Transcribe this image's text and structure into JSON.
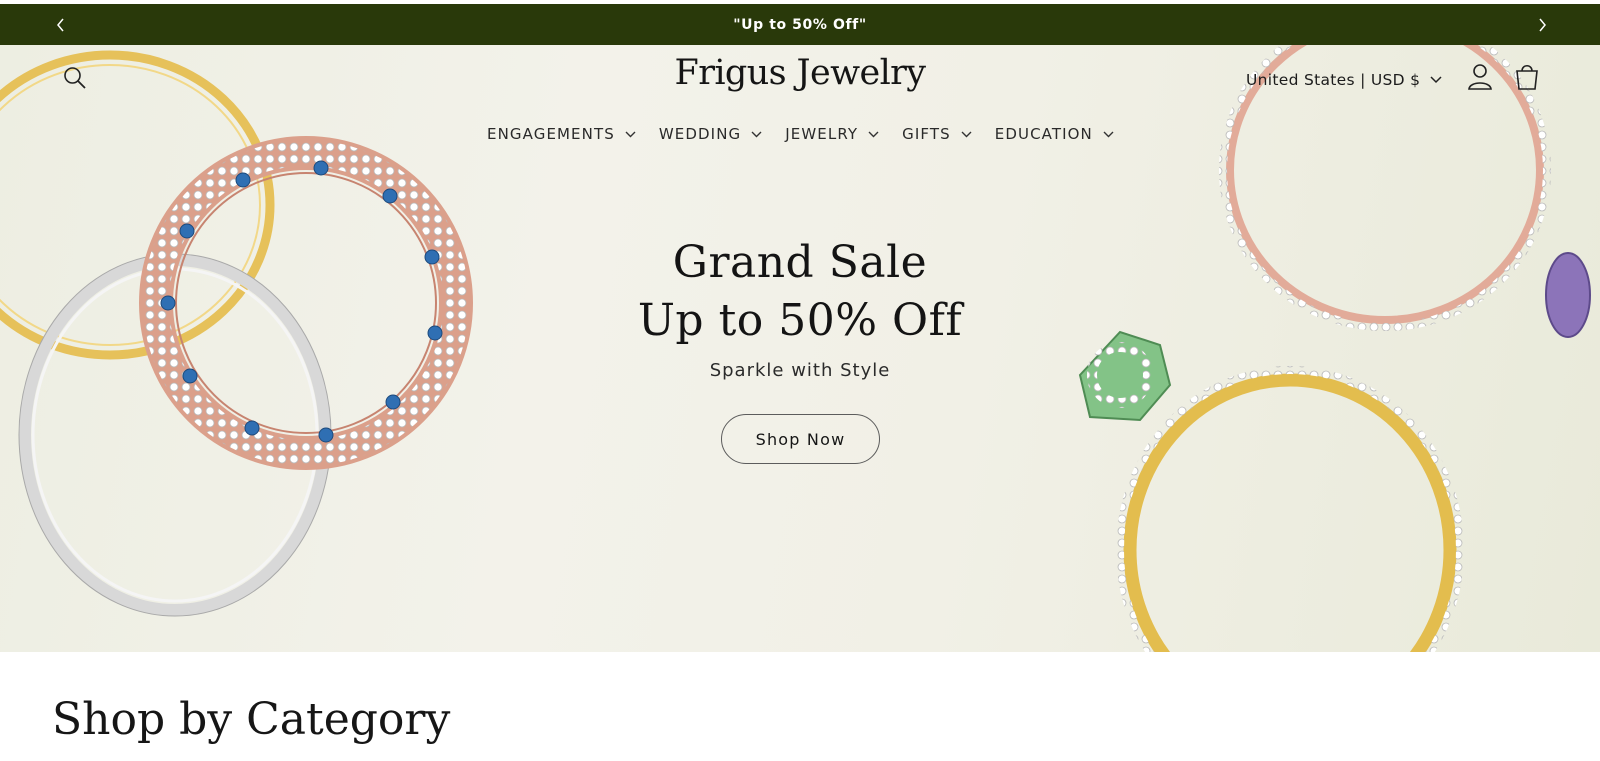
{
  "announcement": {
    "text": "\"Up to 50% Off\"",
    "prev_icon": "chevron-left-icon",
    "next_icon": "chevron-right-icon",
    "background": "#29390a"
  },
  "header": {
    "brand": "Frigus Jewelry",
    "locale": "United States | USD $",
    "icons": [
      "search-icon",
      "account-icon",
      "cart-icon",
      "chevron-down-icon"
    ]
  },
  "nav": {
    "items": [
      {
        "label": "ENGAGEMENTS"
      },
      {
        "label": "WEDDING"
      },
      {
        "label": "JEWELRY"
      },
      {
        "label": "GIFTS"
      },
      {
        "label": "EDUCATION"
      }
    ]
  },
  "hero": {
    "title_line1": "Grand Sale",
    "title_line2": "Up to 50% Off",
    "subtitle": "Sparkle with Style",
    "cta": "Shop Now"
  },
  "categories": {
    "heading": "Shop by Category"
  },
  "colors": {
    "accent": "#29390a",
    "hero_background": "#f1f0e6",
    "rose_gold": "#d99a86",
    "gold": "#e3bd4e",
    "silver": "#d4d4d4"
  }
}
